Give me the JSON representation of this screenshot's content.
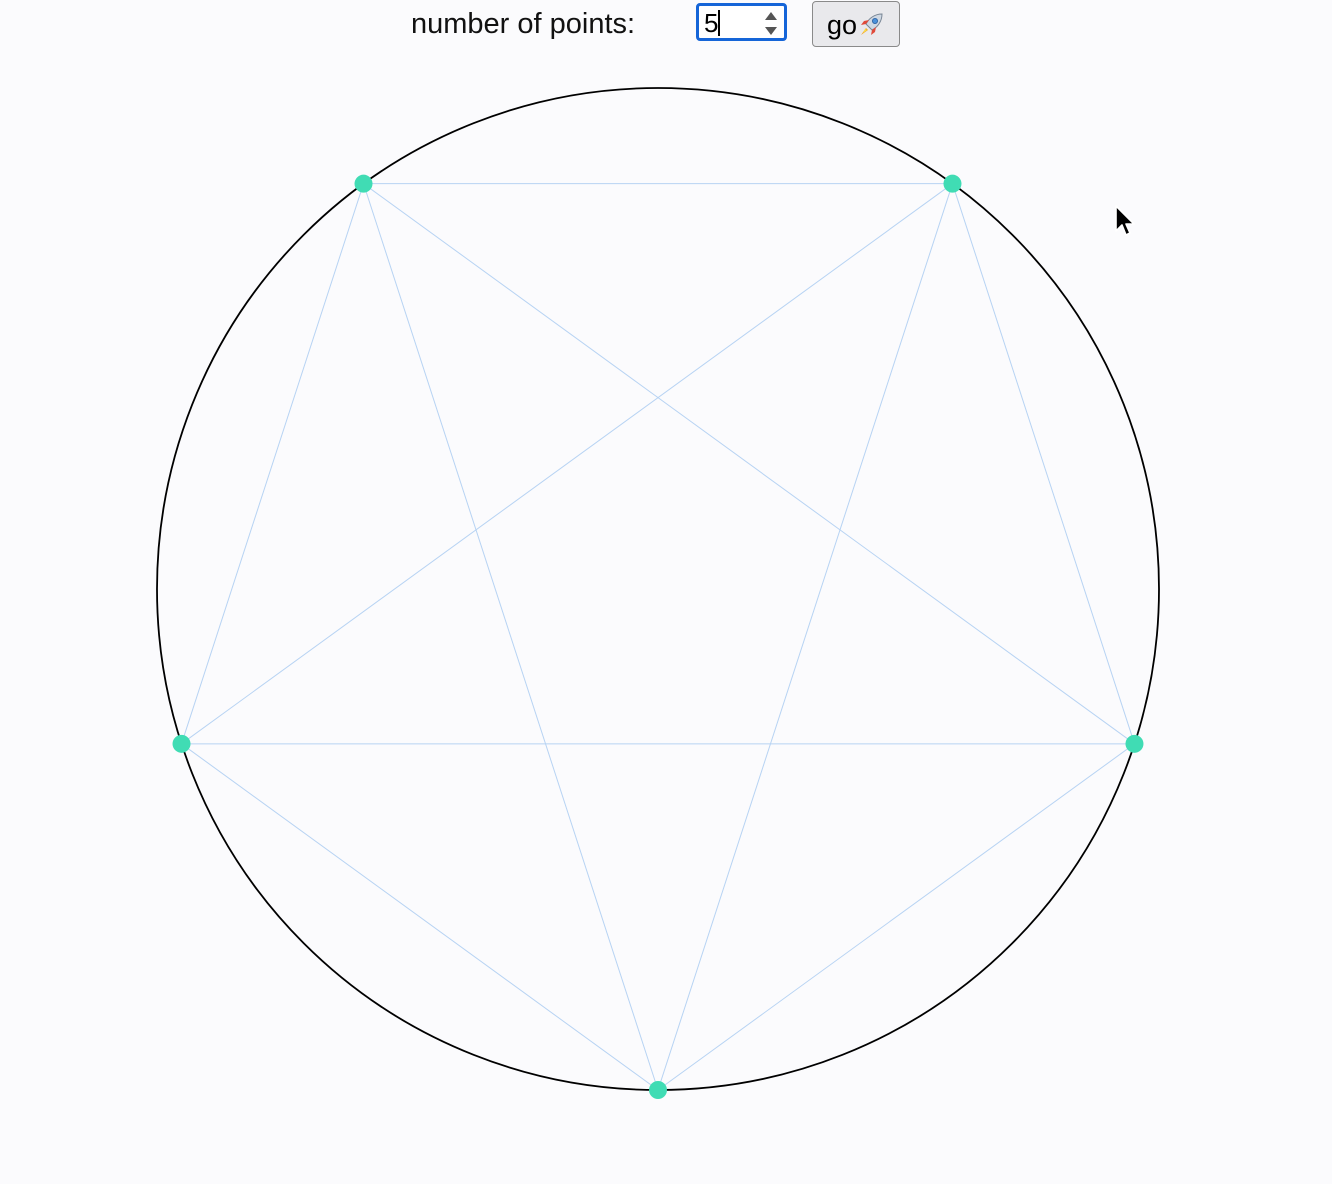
{
  "controls": {
    "label": "number of points:",
    "count_value": "5",
    "go_label": "go"
  },
  "icons": {
    "go_button_icon": "rocket-icon",
    "spinner_up": "chevron-up-icon",
    "spinner_down": "chevron-down-icon",
    "pointer": "mouse-cursor-icon"
  },
  "colors": {
    "background": "#fbfbfd",
    "circle_stroke": "#000000",
    "chord_stroke": "#b7d3f3",
    "point_fill": "#40dcb4",
    "input_focus_border": "#1565d8"
  },
  "drawing": {
    "points": 5,
    "connect_all_pairs": true
  }
}
